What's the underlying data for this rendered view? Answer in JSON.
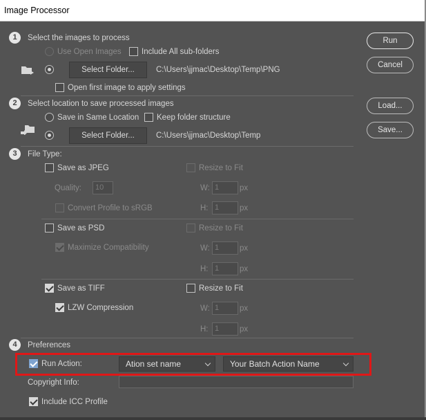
{
  "window": {
    "title": "Image Processor"
  },
  "section1": {
    "step": "1",
    "heading": "Select the images to process",
    "use_open_images": "Use Open Images",
    "include_subfolders": "Include All sub-folders",
    "select_folder": "Select Folder...",
    "folder_path": "C:\\Users\\jjmac\\Desktop\\Temp\\PNG",
    "open_first": "Open first image to apply settings"
  },
  "section2": {
    "step": "2",
    "heading": "Select location to save processed images",
    "save_same": "Save in Same Location",
    "keep_structure": "Keep folder structure",
    "select_folder": "Select Folder...",
    "folder_path": "C:\\Users\\jjmac\\Desktop\\Temp"
  },
  "section3": {
    "step": "3",
    "heading": "File Type:",
    "jpeg": {
      "label": "Save as JPEG",
      "checked": false,
      "resize": "Resize to Fit",
      "quality_label": "Quality:",
      "quality_value": "10",
      "convert": "Convert Profile to sRGB",
      "w_label": "W:",
      "w_value": "1",
      "h_label": "H:",
      "h_value": "1",
      "unit": "px"
    },
    "psd": {
      "label": "Save as PSD",
      "checked": false,
      "resize": "Resize to Fit",
      "maximize": "Maximize Compatibility",
      "w_label": "W:",
      "w_value": "1",
      "h_label": "H:",
      "h_value": "1",
      "unit": "px"
    },
    "tiff": {
      "label": "Save as TIFF",
      "checked": true,
      "resize": "Resize to Fit",
      "lzw": "LZW Compression",
      "w_label": "W:",
      "w_value": "1",
      "h_label": "H:",
      "h_value": "1",
      "unit": "px"
    }
  },
  "section4": {
    "step": "4",
    "heading": "Preferences",
    "run_action": "Run Action:",
    "action_set": "Ation set name",
    "action_name": "Your Batch Action Name",
    "copyright": "Copyright Info:",
    "copyright_value": "",
    "icc": "Include ICC Profile"
  },
  "buttons": {
    "run": "Run",
    "cancel": "Cancel",
    "load": "Load...",
    "save": "Save..."
  },
  "colors": {
    "highlight": "#e01717",
    "background": "#535353"
  }
}
